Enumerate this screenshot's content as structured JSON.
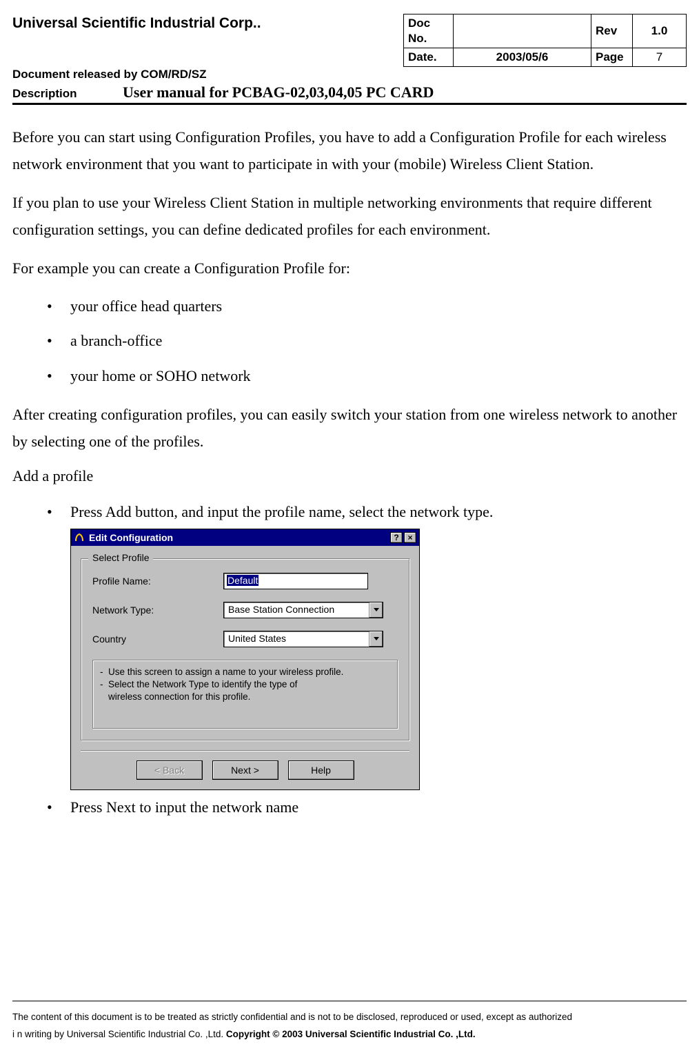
{
  "header": {
    "company": "Universal Scientific Industrial Corp..",
    "released": "Document released by  COM/RD/SZ",
    "doc_no_label": "Doc No.",
    "doc_no_value": "",
    "rev_label": "Rev",
    "rev_value": "1.0",
    "date_label": "Date.",
    "date_value": "2003/05/6",
    "page_label": "Page",
    "page_value": "7",
    "description_label": "Description",
    "description_title": "User manual for PCBAG-02,03,04,05 PC CARD"
  },
  "body": {
    "p1": "Before you can start using Configuration Profiles, you have to add a Configuration Profile for each wireless network environment that you want to participate in with your (mobile) Wireless Client Station.",
    "p2": "If you plan to use your Wireless Client Station in multiple networking environments that require different configuration settings, you can define dedicated profiles for each environment.",
    "p3": "For example you can create a Configuration Profile for:",
    "bullets1": [
      "your office head quarters",
      "a branch-office",
      "your home or SOHO network"
    ],
    "p4": "After creating configuration profiles, you can easily switch your station from one wireless network to another by selecting one of the profiles.",
    "section_head": "Add a profile",
    "bullet_a": "Press Add button, and input the profile name, select the network type.",
    "bullet_b": "Press Next to input the network name"
  },
  "dialog": {
    "title": "Edit Configuration",
    "help_btn": "?",
    "close_btn": "×",
    "group_legend": "Select Profile",
    "profile_name_label": "Profile Name:",
    "profile_name_value": "Default",
    "network_type_label": "Network Type:",
    "network_type_value": "Base Station Connection",
    "country_label": "Country",
    "country_value": "United States",
    "info_line1": "Use this screen to assign a name to your wireless profile.",
    "info_line2a": "Select the Network Type to identify the type of",
    "info_line2b": "wireless connection for this profile.",
    "btn_back": "< Back",
    "btn_next": "Next >",
    "btn_help": "Help"
  },
  "footer": {
    "line1": "The content of this document is to be treated as strictly confidential and is not to be disclosed, reproduced or used, except as authorized",
    "line2a": "i n writing by Universal Scientific Industrial Co. ,Ltd.   ",
    "line2b": "Copyright © 2003 Universal Scientific Industrial Co. ,Ltd."
  }
}
